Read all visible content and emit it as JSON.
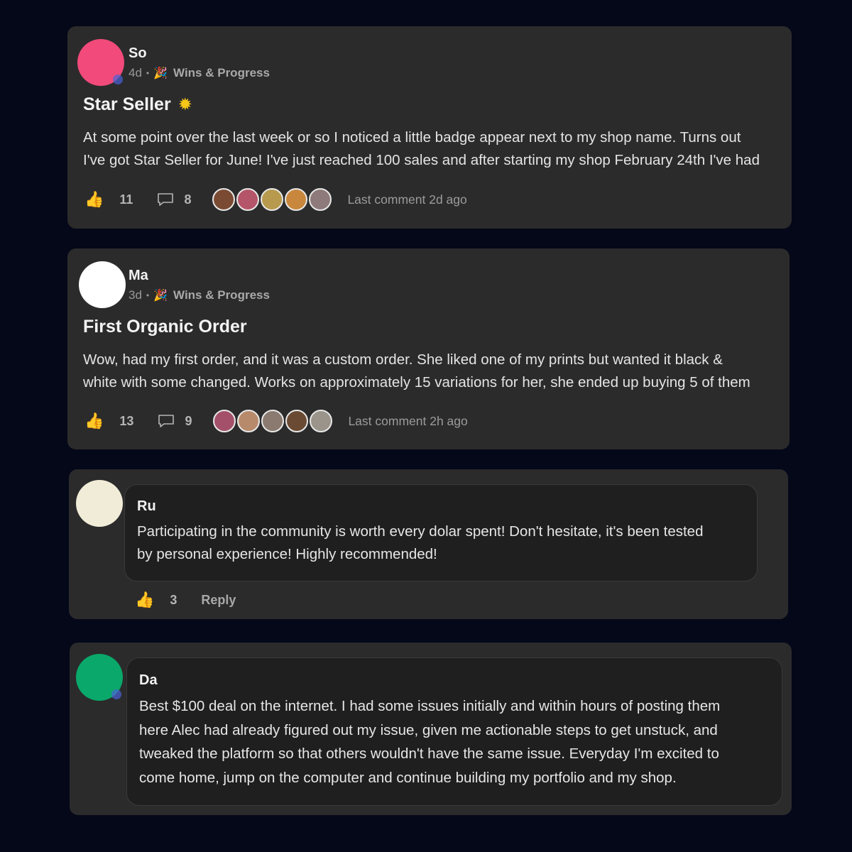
{
  "posts": [
    {
      "author": "So",
      "age": "4d",
      "category": "Wins & Progress",
      "category_icon": "party-popper-icon",
      "title": "Star Seller",
      "title_icon": "sun-icon",
      "body_line1": "At some point over the last week or so I noticed a little badge appear next to my shop name. Turns out",
      "body_line2": "I've got Star Seller for June! I've just reached 100 sales and after starting my shop February 24th I've had",
      "likes": "11",
      "comments": "8",
      "last_comment": "Last comment 2d ago",
      "avatar_color": "#f24a7a",
      "face_colors": [
        "#7a4a33",
        "#b5556a",
        "#b89a4e",
        "#c8873c",
        "#8e7a7a"
      ]
    },
    {
      "author": "Ma",
      "age": "3d",
      "category": "Wins & Progress",
      "category_icon": "party-popper-icon",
      "title": "First Organic Order",
      "body_line1": "Wow, had my first order, and it was a custom order. She liked one of my prints but wanted it black &",
      "body_line2": "white with some changed. Works on approximately 15 variations for her, she ended up buying 5 of them",
      "likes": "13",
      "comments": "9",
      "last_comment": "Last comment 2h ago",
      "avatar_color": "#ffffff",
      "face_colors": [
        "#a5506b",
        "#b88a6c",
        "#8a7a70",
        "#6a4a33",
        "#9a948a"
      ]
    }
  ],
  "replies": [
    {
      "author": "Ru",
      "line1": "Participating in the community is worth every dolar spent! Don't hesitate, it's been tested",
      "line2": "by personal experience! Highly recommended!",
      "likes": "3",
      "reply_label": "Reply",
      "avatar_color": "#f1ecd8"
    },
    {
      "author": "Da",
      "line1": "Best $100 deal on the internet. I had some issues initially and within hours of posting them",
      "line2": "here Alec had already figured out my issue, given me actionable steps to get unstuck, and",
      "line3": "tweaked the platform so that others wouldn't have the same issue. Everyday I'm excited to",
      "line4": "come home, jump on the computer and continue building my portfolio and my shop.",
      "avatar_color": "#0aa86a"
    }
  ],
  "colors": {
    "background": "#050818",
    "card": "#2b2b2c",
    "like_icon": "#f3b52a"
  }
}
